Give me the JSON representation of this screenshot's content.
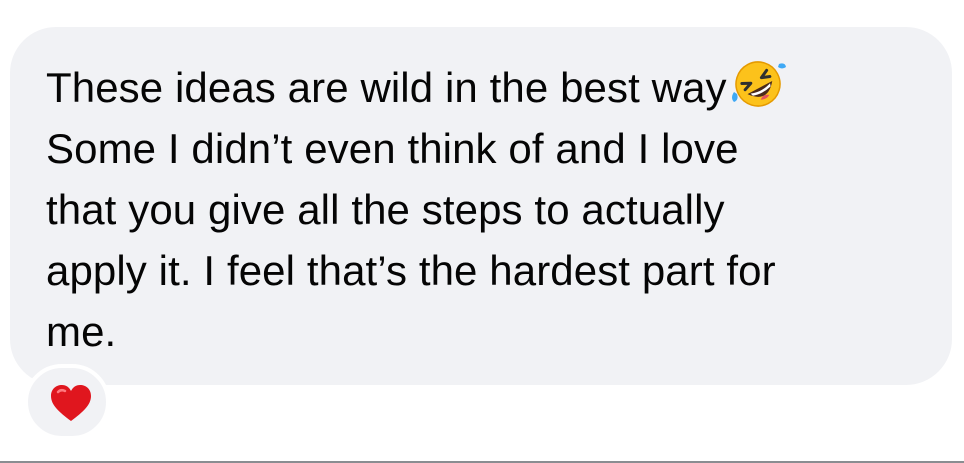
{
  "message": {
    "lines": [
      "These ideas are wild in the best way",
      "Some I didn’t even think of and I love",
      "that you give all the steps to actually",
      "apply it. I feel that’s the hardest part for",
      "me."
    ],
    "inline_emoji": "rolling-on-the-floor-laughing-icon"
  },
  "reaction": {
    "icon": "red-heart-icon",
    "color": "#e0161e"
  },
  "colors": {
    "bubble": "#f1f2f5",
    "text": "#050505",
    "background": "#ffffff"
  }
}
